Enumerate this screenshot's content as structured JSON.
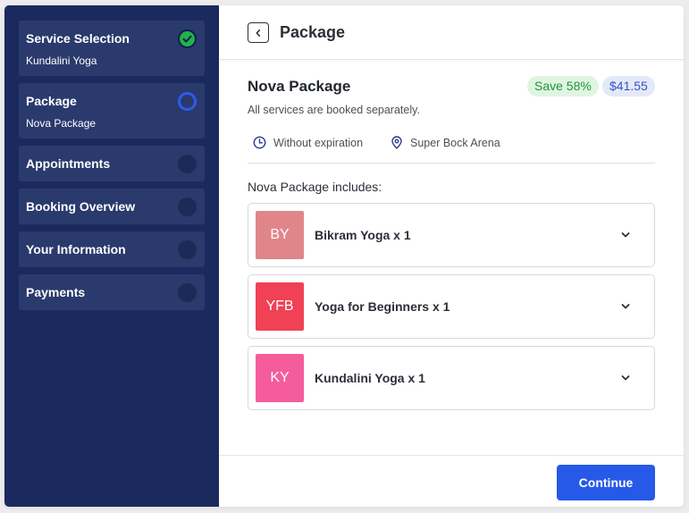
{
  "sidebar": {
    "steps": [
      {
        "label": "Service Selection",
        "sub": "Kundalini Yoga",
        "state": "done"
      },
      {
        "label": "Package",
        "sub": "Nova Package",
        "state": "active"
      },
      {
        "label": "Appointments",
        "state": "pending"
      },
      {
        "label": "Booking Overview",
        "state": "pending"
      },
      {
        "label": "Your Information",
        "state": "pending"
      },
      {
        "label": "Payments",
        "state": "pending"
      }
    ]
  },
  "header": {
    "title": "Package"
  },
  "package": {
    "title": "Nova Package",
    "save_badge": "Save 58%",
    "price_badge": "$41.55",
    "description": "All services are booked separately.",
    "expiration": "Without expiration",
    "location": "Super Bock Arena",
    "includes_label": "Nova Package includes:"
  },
  "services": [
    {
      "initials": "BY",
      "name": "Bikram Yoga x 1",
      "color": "#e0868a"
    },
    {
      "initials": "YFB",
      "name": "Yoga for Beginners x 1",
      "color": "#f04155"
    },
    {
      "initials": "KY",
      "name": "Kundalini Yoga x 1",
      "color": "#f55c9b"
    }
  ],
  "footer": {
    "continue_label": "Continue"
  },
  "colors": {
    "sidebar_bg": "#1a2a5e",
    "step_bg": "#2a3a6c",
    "accent": "#2659e8",
    "done": "#22b14c"
  }
}
